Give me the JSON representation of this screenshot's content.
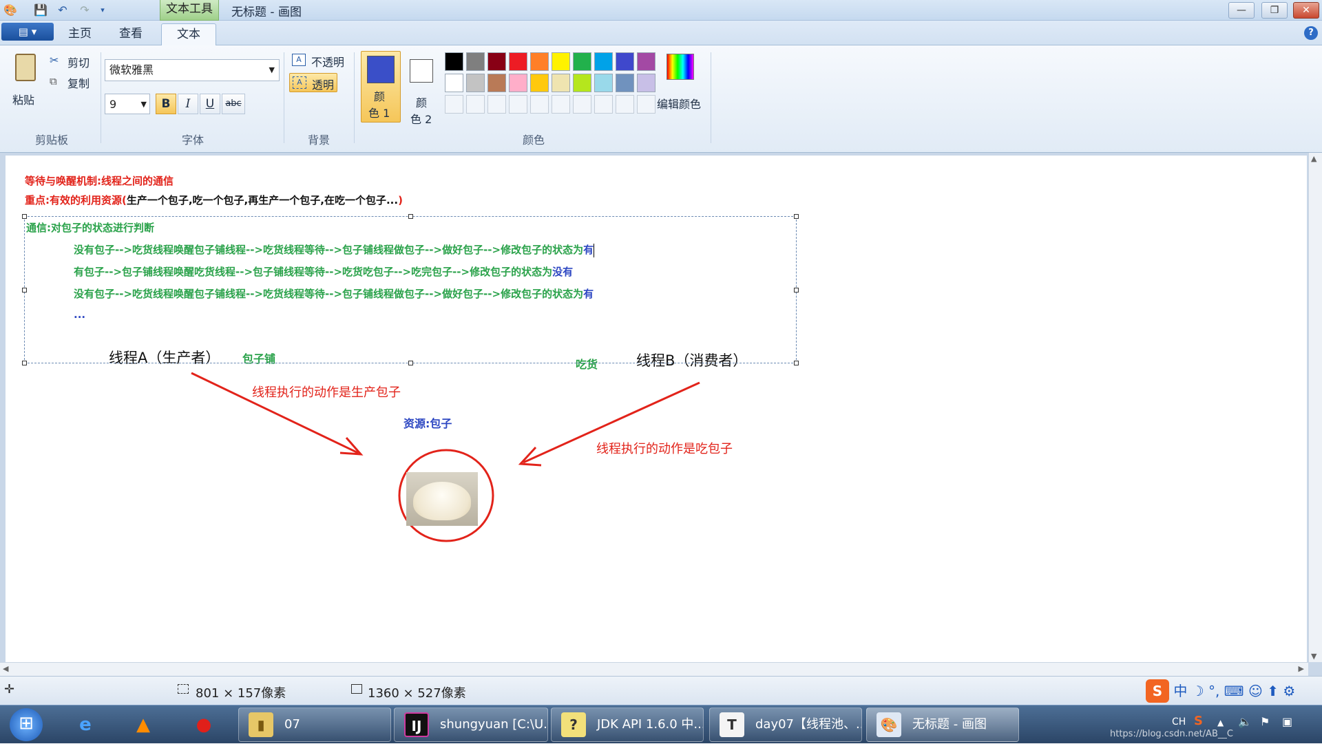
{
  "window": {
    "title": "无标题 - 画图",
    "context_tab": "文本工具",
    "controls": {
      "minimize": "—",
      "maximize": "❐",
      "close": "✕"
    }
  },
  "tabs": {
    "home": "主页",
    "view": "查看",
    "text": "文本",
    "help": "?"
  },
  "ribbon": {
    "clipboard": {
      "paste": "粘贴",
      "cut": "剪切",
      "copy": "复制",
      "group": "剪贴板"
    },
    "font": {
      "family": "微软雅黑",
      "size": "9",
      "bold": "B",
      "italic": "I",
      "underline": "U",
      "strike": "abc",
      "group": "字体"
    },
    "background": {
      "opaque": "不透明",
      "transparent": "透明",
      "group": "背景"
    },
    "colors": {
      "color1_line1": "颜",
      "color1_line2": "色 1",
      "color2_line1": "颜",
      "color2_line2": "色 2",
      "edit": "编辑颜色",
      "group": "颜色",
      "color1": "#3a4fc8",
      "color2": "#ffffff",
      "palette_row1": [
        "#000000",
        "#7f7f7f",
        "#880015",
        "#ed1c24",
        "#ff7f27",
        "#fff200",
        "#22b14c",
        "#00a2e8",
        "#3f48cc",
        "#a349a4"
      ],
      "palette_row2": [
        "#ffffff",
        "#c3c3c3",
        "#b97a57",
        "#ffaec9",
        "#ffc90e",
        "#efe4b0",
        "#b5e61d",
        "#99d9ea",
        "#7092be",
        "#c8bfe7"
      ]
    }
  },
  "canvas": {
    "line1": "等待与唤醒机制:线程之间的通信",
    "line2_red": "重点:有效的利用资源(",
    "line2_black": "生产一个包子,吃一个包子,再生产一个包子,在吃一个包子...",
    "line2_close": ")",
    "comm_title": "通信:对包子的状态进行判断",
    "row1_green": "没有包子-->吃货线程唤醒包子铺线程-->吃货线程等待-->包子铺线程做包子-->做好包子-->修改包子的状态为",
    "row1_blue": "有",
    "row2_green": "有包子-->包子铺线程唤醒吃货线程-->包子铺线程等待-->吃货吃包子-->吃完包子-->修改包子的状态为",
    "row2_blue": "没有",
    "row3_green": "没有包子-->吃货线程唤醒包子铺线程-->吃货线程等待-->包子铺线程做包子-->做好包子-->修改包子的状态为",
    "row3_blue": "有",
    "ellipsis": "...",
    "threadA": "线程A（生产者）",
    "shop": "包子铺",
    "eater": "吃货",
    "threadB": "线程B（消费者）",
    "action_produce": "线程执行的动作是生产包子",
    "resource": "资源:包子",
    "action_consume": "线程执行的动作是吃包子"
  },
  "status": {
    "selection_size": "801 × 157像素",
    "canvas_size": "1360 × 527像素"
  },
  "taskbar": {
    "folder": "07",
    "idea": "shungyuan [C:\\U...",
    "jdk": "JDK API 1.6.0 中...",
    "typora": "day07【线程池、...",
    "paint": "无标题 - 画图",
    "tray_lang": "CH",
    "watermark": "https://blog.csdn.net/AB__C"
  }
}
